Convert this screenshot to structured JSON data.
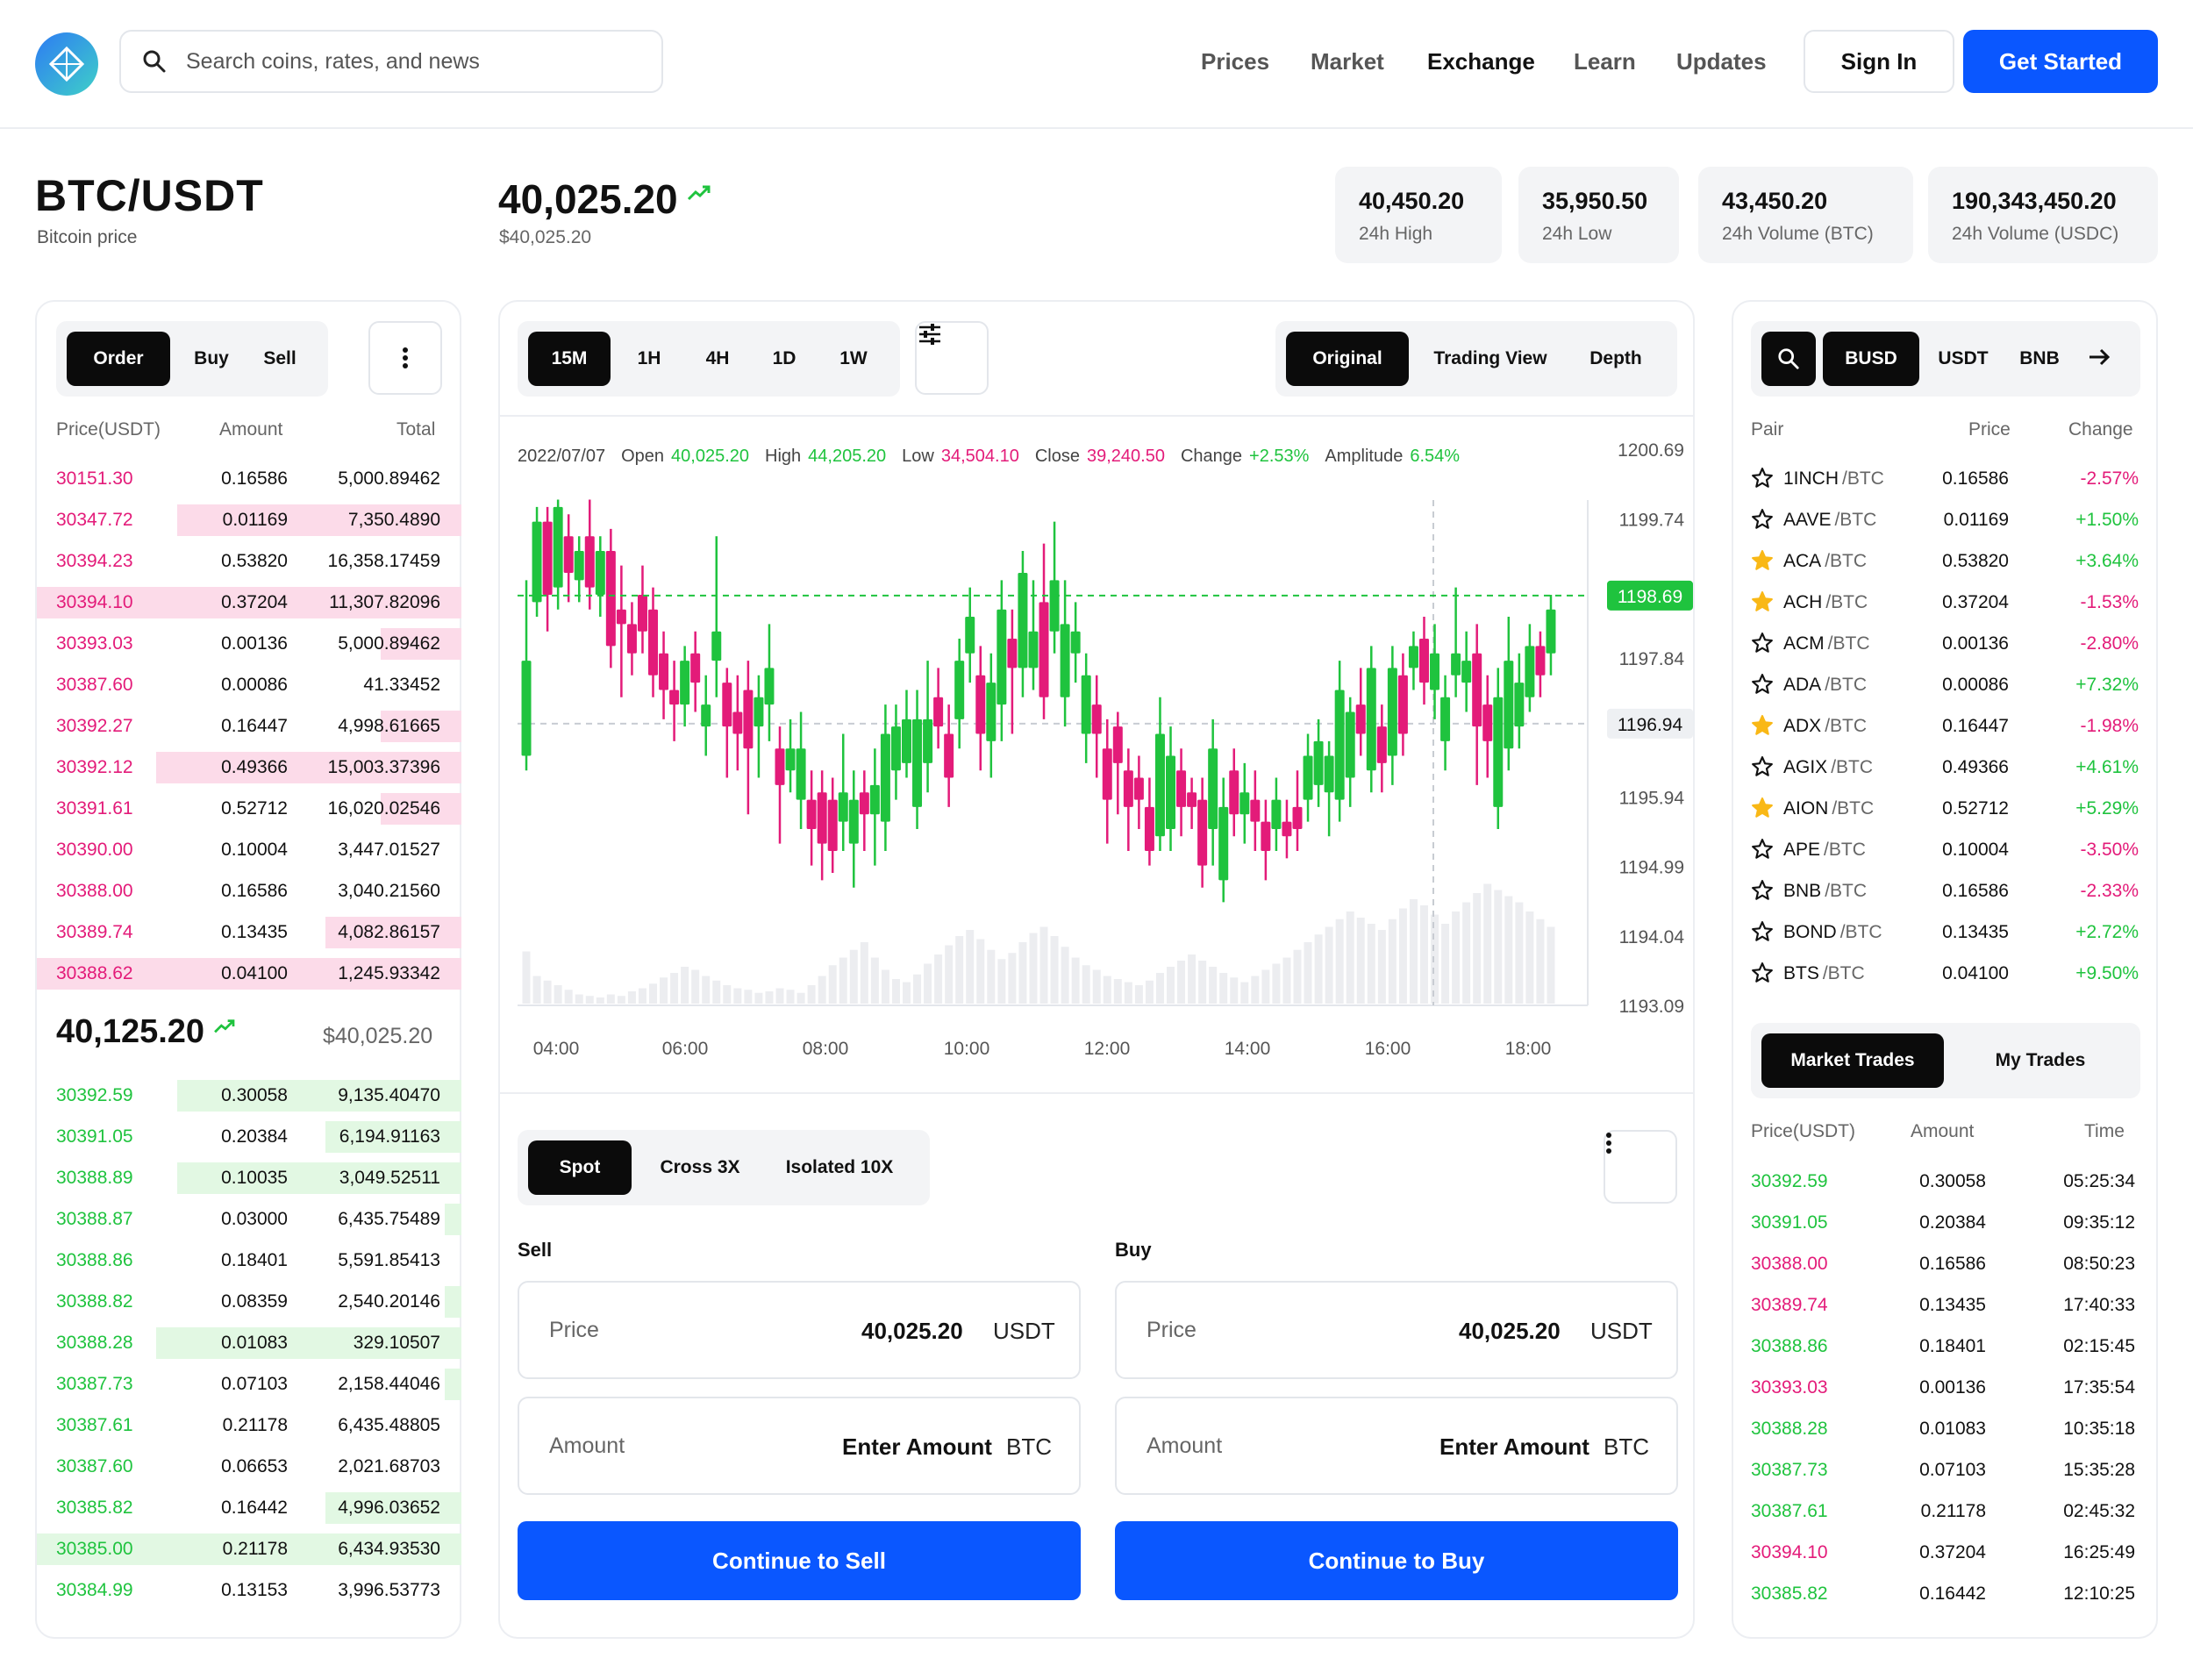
{
  "header": {
    "search_placeholder": "Search coins, rates, and news",
    "nav": [
      "Prices",
      "Market",
      "Exchange",
      "Learn",
      "Updates"
    ],
    "active_nav": "Exchange",
    "sign_in": "Sign In",
    "get_started": "Get Started"
  },
  "pair": {
    "title": "BTC/USDT",
    "subtitle": "Bitcoin price",
    "price": "40,025.20",
    "price_usd": "$40,025.20"
  },
  "stats": [
    {
      "value": "40,450.20",
      "label": "24h High"
    },
    {
      "value": "35,950.50",
      "label": "24h Low"
    },
    {
      "value": "43,450.20",
      "label": "24h Volume (BTC)"
    },
    {
      "value": "190,343,450.20",
      "label": "24h Volume (USDC)"
    }
  ],
  "orderbook": {
    "tabs": [
      "Order",
      "Buy",
      "Sell"
    ],
    "headers": [
      "Price(USDT)",
      "Amount",
      "Total"
    ],
    "asks": [
      [
        "30151.30",
        "0.16586",
        "5,000.89462",
        0
      ],
      [
        "30347.72",
        "0.01169",
        "7,350.4890",
        0.67
      ],
      [
        "30394.23",
        "0.53820",
        "16,358.17459",
        0
      ],
      [
        "30394.10",
        "0.37204",
        "11,307.82096",
        1.0
      ],
      [
        "30393.03",
        "0.00136",
        "5,000.89462",
        0.19
      ],
      [
        "30387.60",
        "0.00086",
        "41.33452",
        0
      ],
      [
        "30392.27",
        "0.16447",
        "4,998.61665",
        0.19
      ],
      [
        "30392.12",
        "0.49366",
        "15,003.37396",
        0.72
      ],
      [
        "30391.61",
        "0.52712",
        "16,020.02546",
        0.19
      ],
      [
        "30390.00",
        "0.10004",
        "3,447.01527",
        0
      ],
      [
        "30388.00",
        "0.16586",
        "3,040.21560",
        0
      ],
      [
        "30389.74",
        "0.13435",
        "4,082.86157",
        0.32
      ],
      [
        "30388.62",
        "0.04100",
        "1,245.93342",
        1.0
      ]
    ],
    "mid_price": "40,125.20",
    "mid_usd": "$40,025.20",
    "bids": [
      [
        "30392.59",
        "0.30058",
        "9,135.40470",
        0.67
      ],
      [
        "30391.05",
        "0.20384",
        "6,194.91163",
        0.32
      ],
      [
        "30388.89",
        "0.10035",
        "3,049.52511",
        0.67
      ],
      [
        "30388.87",
        "0.03000",
        "6,435.75489",
        0.04
      ],
      [
        "30388.86",
        "0.18401",
        "5,591.85413",
        0
      ],
      [
        "30388.82",
        "0.08359",
        "2,540.20146",
        0.04
      ],
      [
        "30388.28",
        "0.01083",
        "329.10507",
        0.72
      ],
      [
        "30387.73",
        "0.07103",
        "2,158.44046",
        0.04
      ],
      [
        "30387.61",
        "0.21178",
        "6,435.48805",
        0
      ],
      [
        "30387.60",
        "0.06653",
        "2,021.68703",
        0
      ],
      [
        "30385.82",
        "0.16442",
        "4,996.03652",
        0.32
      ],
      [
        "30385.00",
        "0.21178",
        "6,434.93530",
        1.0
      ],
      [
        "30384.99",
        "0.13153",
        "3,996.53773",
        0
      ]
    ]
  },
  "chart": {
    "intervals": [
      "15M",
      "1H",
      "4H",
      "1D",
      "1W"
    ],
    "active_interval": "15M",
    "views": [
      "Original",
      "Trading View",
      "Depth"
    ],
    "active_view": "Original",
    "ohlc": {
      "date": "2022/07/07",
      "open_label": "Open",
      "open": "40,025.20",
      "high_label": "High",
      "high": "44,205.20",
      "low_label": "Low",
      "low": "34,504.10",
      "close_label": "Close",
      "close": "39,240.50",
      "change_label": "Change",
      "change": "+2.53%",
      "amp_label": "Amplitude",
      "amp": "6.54%"
    },
    "y_ticks": [
      "1200.69",
      "1199.74",
      "1198.69",
      "1197.84",
      "1196.94",
      "1195.94",
      "1194.99",
      "1194.04",
      "1193.09"
    ],
    "x_ticks": [
      "04:00",
      "06:00",
      "08:00",
      "10:00",
      "12:00",
      "14:00",
      "16:00",
      "18:00"
    ],
    "current_label": "1198.69",
    "cross_label": "1196.94",
    "candles": [
      [
        1196.5,
        1197.8,
        1198.9,
        1196.3
      ],
      [
        1198.6,
        1199.7,
        1199.9,
        1198.4
      ],
      [
        1199.7,
        1198.7,
        1199.9,
        1198.2
      ],
      [
        1198.8,
        1199.9,
        1200.0,
        1198.5
      ],
      [
        1199.5,
        1199.0,
        1199.8,
        1198.6
      ],
      [
        1198.9,
        1199.3,
        1199.5,
        1198.6
      ],
      [
        1199.5,
        1198.8,
        1200.0,
        1198.5
      ],
      [
        1198.7,
        1199.3,
        1199.5,
        1198.4
      ],
      [
        1199.3,
        1198.0,
        1199.6,
        1197.7
      ],
      [
        1198.5,
        1198.3,
        1199.1,
        1197.3
      ],
      [
        1198.3,
        1197.9,
        1198.6,
        1197.6
      ],
      [
        1198.7,
        1198.2,
        1199.1,
        1197.9
      ],
      [
        1198.5,
        1197.6,
        1198.8,
        1197.3
      ],
      [
        1197.9,
        1197.4,
        1198.2,
        1197.0
      ],
      [
        1197.4,
        1197.2,
        1197.8,
        1196.7
      ],
      [
        1197.2,
        1197.8,
        1198.0,
        1196.9
      ],
      [
        1197.9,
        1197.5,
        1198.2,
        1197.1
      ],
      [
        1196.9,
        1197.2,
        1197.6,
        1196.5
      ],
      [
        1197.8,
        1198.2,
        1199.5,
        1197.3
      ],
      [
        1197.5,
        1196.9,
        1197.7,
        1196.2
      ],
      [
        1197.1,
        1196.8,
        1197.6,
        1196.3
      ],
      [
        1197.4,
        1196.6,
        1197.8,
        1195.7
      ],
      [
        1196.9,
        1197.3,
        1197.6,
        1196.2
      ],
      [
        1197.2,
        1197.7,
        1198.3,
        1196.7
      ],
      [
        1196.6,
        1196.1,
        1196.9,
        1195.3
      ],
      [
        1196.3,
        1196.6,
        1197.0,
        1196.0
      ],
      [
        1195.9,
        1196.6,
        1197.1,
        1195.5
      ],
      [
        1195.9,
        1195.5,
        1196.3,
        1195.0
      ],
      [
        1196.0,
        1195.3,
        1196.3,
        1194.8
      ],
      [
        1195.9,
        1195.2,
        1196.2,
        1194.9
      ],
      [
        1195.6,
        1196.0,
        1196.8,
        1195.2
      ],
      [
        1195.3,
        1195.9,
        1196.3,
        1194.7
      ],
      [
        1196.0,
        1195.7,
        1196.3,
        1195.2
      ],
      [
        1195.7,
        1196.1,
        1196.6,
        1195.0
      ],
      [
        1195.6,
        1196.8,
        1197.2,
        1195.2
      ],
      [
        1196.3,
        1196.9,
        1197.2,
        1195.9
      ],
      [
        1196.4,
        1197.0,
        1197.4,
        1196.2
      ],
      [
        1195.8,
        1197.0,
        1197.4,
        1195.5
      ],
      [
        1196.4,
        1197.0,
        1197.8,
        1196.0
      ],
      [
        1197.3,
        1196.9,
        1197.7,
        1196.6
      ],
      [
        1196.8,
        1196.2,
        1197.2,
        1195.8
      ],
      [
        1197.0,
        1197.8,
        1198.1,
        1196.6
      ],
      [
        1197.9,
        1198.4,
        1198.8,
        1197.5
      ],
      [
        1197.6,
        1196.8,
        1198.0,
        1196.3
      ],
      [
        1196.7,
        1197.5,
        1197.9,
        1196.2
      ],
      [
        1197.2,
        1198.5,
        1198.9,
        1196.7
      ],
      [
        1198.1,
        1197.7,
        1198.5,
        1196.8
      ],
      [
        1197.7,
        1199.0,
        1199.3,
        1197.3
      ],
      [
        1197.7,
        1198.2,
        1198.9,
        1197.4
      ],
      [
        1198.6,
        1197.3,
        1199.4,
        1197.0
      ],
      [
        1198.2,
        1198.9,
        1199.7,
        1197.9
      ],
      [
        1197.3,
        1198.3,
        1198.9,
        1196.9
      ],
      [
        1197.9,
        1198.2,
        1198.6,
        1197.5
      ],
      [
        1196.8,
        1197.6,
        1197.9,
        1196.4
      ],
      [
        1197.2,
        1196.8,
        1197.6,
        1196.2
      ],
      [
        1196.6,
        1195.9,
        1197.0,
        1195.3
      ],
      [
        1196.9,
        1196.4,
        1197.1,
        1195.7
      ],
      [
        1196.3,
        1195.8,
        1196.6,
        1195.2
      ],
      [
        1196.2,
        1195.9,
        1196.5,
        1195.5
      ],
      [
        1195.8,
        1195.2,
        1196.2,
        1195.0
      ],
      [
        1195.4,
        1196.8,
        1197.3,
        1195.2
      ],
      [
        1195.5,
        1196.5,
        1196.9,
        1195.2
      ],
      [
        1196.3,
        1195.8,
        1196.6,
        1195.4
      ],
      [
        1196.0,
        1195.8,
        1196.2,
        1195.5
      ],
      [
        1195.9,
        1195.0,
        1196.2,
        1194.7
      ],
      [
        1195.5,
        1196.6,
        1197.0,
        1195.0
      ],
      [
        1194.8,
        1195.8,
        1196.2,
        1194.5
      ],
      [
        1196.3,
        1195.7,
        1196.6,
        1195.4
      ],
      [
        1195.7,
        1196.0,
        1196.4,
        1195.3
      ],
      [
        1195.9,
        1195.6,
        1196.3,
        1195.2
      ],
      [
        1195.6,
        1195.2,
        1195.9,
        1194.8
      ],
      [
        1195.5,
        1195.9,
        1196.2,
        1195.2
      ],
      [
        1195.6,
        1195.4,
        1195.9,
        1195.1
      ],
      [
        1195.8,
        1195.5,
        1196.3,
        1195.2
      ],
      [
        1195.9,
        1196.5,
        1196.8,
        1195.6
      ],
      [
        1196.1,
        1196.7,
        1197.0,
        1195.8
      ],
      [
        1196.0,
        1196.5,
        1196.7,
        1195.4
      ],
      [
        1195.9,
        1197.4,
        1197.8,
        1195.6
      ],
      [
        1196.2,
        1197.1,
        1197.3,
        1195.8
      ],
      [
        1197.2,
        1196.8,
        1197.7,
        1196.5
      ],
      [
        1196.3,
        1197.7,
        1198.0,
        1196.0
      ],
      [
        1196.9,
        1196.4,
        1197.2,
        1196.0
      ],
      [
        1196.5,
        1197.7,
        1198.0,
        1196.1
      ],
      [
        1197.6,
        1196.8,
        1197.9,
        1196.5
      ],
      [
        1197.7,
        1198.0,
        1198.2,
        1197.4
      ],
      [
        1198.1,
        1197.5,
        1198.4,
        1197.2
      ],
      [
        1197.4,
        1197.9,
        1198.3,
        1197.0
      ],
      [
        1196.7,
        1197.3,
        1197.6,
        1196.3
      ],
      [
        1197.6,
        1197.9,
        1198.8,
        1197.3
      ],
      [
        1197.5,
        1197.8,
        1198.2,
        1197.1
      ],
      [
        1197.9,
        1196.9,
        1198.3,
        1196.1
      ],
      [
        1197.2,
        1196.7,
        1197.6,
        1196.2
      ],
      [
        1195.8,
        1197.3,
        1197.7,
        1195.5
      ],
      [
        1196.6,
        1197.8,
        1198.4,
        1196.3
      ],
      [
        1196.9,
        1197.5,
        1197.9,
        1196.6
      ],
      [
        1197.3,
        1198.0,
        1198.3,
        1197.1
      ],
      [
        1198.0,
        1197.6,
        1198.2,
        1197.3
      ],
      [
        1197.9,
        1198.5,
        1198.7,
        1197.6
      ]
    ],
    "volume": [
      0.34,
      0.18,
      0.15,
      0.12,
      0.09,
      0.06,
      0.05,
      0.04,
      0.06,
      0.05,
      0.08,
      0.1,
      0.13,
      0.17,
      0.2,
      0.24,
      0.22,
      0.18,
      0.15,
      0.12,
      0.1,
      0.09,
      0.07,
      0.08,
      0.1,
      0.09,
      0.07,
      0.12,
      0.18,
      0.25,
      0.3,
      0.35,
      0.4,
      0.3,
      0.22,
      0.16,
      0.14,
      0.19,
      0.26,
      0.32,
      0.38,
      0.44,
      0.48,
      0.42,
      0.35,
      0.29,
      0.33,
      0.4,
      0.46,
      0.5,
      0.44,
      0.37,
      0.3,
      0.25,
      0.22,
      0.18,
      0.16,
      0.14,
      0.12,
      0.15,
      0.2,
      0.24,
      0.28,
      0.32,
      0.28,
      0.24,
      0.2,
      0.17,
      0.14,
      0.18,
      0.22,
      0.26,
      0.3,
      0.35,
      0.4,
      0.45,
      0.5,
      0.55,
      0.6,
      0.56,
      0.52,
      0.48,
      0.55,
      0.62,
      0.68,
      0.64,
      0.58,
      0.52,
      0.6,
      0.66,
      0.72,
      0.78,
      0.74,
      0.7,
      0.66,
      0.6,
      0.55,
      0.5
    ]
  },
  "trade": {
    "modes": [
      "Spot",
      "Cross 3X",
      "Isolated 10X"
    ],
    "active_mode": "Spot",
    "sell_label": "Sell",
    "buy_label": "Buy",
    "price_label": "Price",
    "price_value": "40,025.20",
    "price_unit": "USDT",
    "amount_label": "Amount",
    "amount_value": "Enter Amount",
    "amount_unit": "BTC",
    "sell_button": "Continue to Sell",
    "buy_button": "Continue to Buy"
  },
  "markets": {
    "tabs": [
      "BUSD",
      "USDT",
      "BNB"
    ],
    "active_tab": "BUSD",
    "headers": [
      "Pair",
      "Price",
      "Change"
    ],
    "rows": [
      [
        "1INCH",
        "/BTC",
        "0.16586",
        "-2.57%",
        false
      ],
      [
        "AAVE",
        "/BTC",
        "0.01169",
        "+1.50%",
        false
      ],
      [
        "ACA",
        "/BTC",
        "0.53820",
        "+3.64%",
        true
      ],
      [
        "ACH",
        "/BTC",
        "0.37204",
        "-1.53%",
        true
      ],
      [
        "ACM",
        "/BTC",
        "0.00136",
        "-2.80%",
        false
      ],
      [
        "ADA",
        "/BTC",
        "0.00086",
        "+7.32%",
        false
      ],
      [
        "ADX",
        "/BTC",
        "0.16447",
        "-1.98%",
        true
      ],
      [
        "AGIX",
        "/BTC",
        "0.49366",
        "+4.61%",
        false
      ],
      [
        "AION",
        "/BTC",
        "0.52712",
        "+5.29%",
        true
      ],
      [
        "APE",
        "/BTC",
        "0.10004",
        "-3.50%",
        false
      ],
      [
        "BNB",
        "/BTC",
        "0.16586",
        "-2.33%",
        false
      ],
      [
        "BOND",
        "/BTC",
        "0.13435",
        "+2.72%",
        false
      ],
      [
        "BTS",
        "/BTC",
        "0.04100",
        "+9.50%",
        false
      ]
    ]
  },
  "trades": {
    "tabs": [
      "Market Trades",
      "My Trades"
    ],
    "active_tab": "Market Trades",
    "headers": [
      "Price(USDT)",
      "Amount",
      "Time"
    ],
    "rows": [
      [
        "30392.59",
        "0.30058",
        "05:25:34",
        "up"
      ],
      [
        "30391.05",
        "0.20384",
        "09:35:12",
        "up"
      ],
      [
        "30388.00",
        "0.16586",
        "08:50:23",
        "down"
      ],
      [
        "30389.74",
        "0.13435",
        "17:40:33",
        "down"
      ],
      [
        "30388.86",
        "0.18401",
        "02:15:45",
        "up"
      ],
      [
        "30393.03",
        "0.00136",
        "17:35:54",
        "down"
      ],
      [
        "30388.28",
        "0.01083",
        "10:35:18",
        "up"
      ],
      [
        "30387.73",
        "0.07103",
        "15:35:28",
        "up"
      ],
      [
        "30387.61",
        "0.21178",
        "02:45:32",
        "up"
      ],
      [
        "30394.10",
        "0.37204",
        "16:25:49",
        "down"
      ],
      [
        "30385.82",
        "0.16442",
        "12:10:25",
        "up"
      ]
    ]
  },
  "colors": {
    "accent": "#0a57ff",
    "up": "#1fc33e",
    "down": "#e31b79",
    "ask_bg": "#fcdbe9",
    "bid_bg": "#e2f8e3"
  }
}
